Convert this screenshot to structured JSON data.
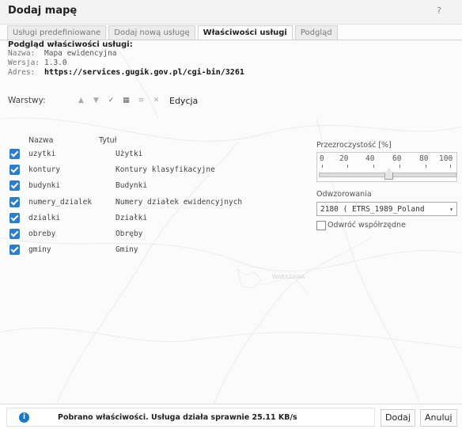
{
  "window": {
    "title": "Dodaj mapę",
    "help_icon": "question-icon"
  },
  "tabs": [
    {
      "label": "Usługi predefiniowane",
      "active": false
    },
    {
      "label": "Dodaj nową usługę",
      "active": false
    },
    {
      "label": "Właściwości usługi",
      "active": true
    },
    {
      "label": "Podgląd",
      "active": false
    }
  ],
  "info": {
    "header": "Podgląd właściwości usługi:",
    "name_label": "Nazwa:",
    "name_value": "Mapa ewidencyjna",
    "version_label": "Wersja:",
    "version_value": "1.3.0",
    "address_label": "Adres:",
    "address_value": "https://services.gugik.gov.pl/cgi-bin/3261"
  },
  "layers_toolbar": {
    "label": "Warstwy:",
    "edit_label": "Edycja",
    "icons": [
      "move-up-icon",
      "move-down-icon",
      "check-icon",
      "properties-icon",
      "list-icon",
      "remove-icon"
    ]
  },
  "layers": {
    "col_name": "Nazwa",
    "col_title": "Tytuł",
    "items": [
      {
        "name": "uzytki",
        "title": "Użytki",
        "checked": true
      },
      {
        "name": "kontury",
        "title": "Kontury klasyfikacyjne",
        "checked": true
      },
      {
        "name": "budynki",
        "title": "Budynki",
        "checked": true
      },
      {
        "name": "numery_dzialek",
        "title": "Numery działek ewidencyjnych",
        "checked": true
      },
      {
        "name": "dzialki",
        "title": "Działki",
        "checked": true
      },
      {
        "name": "obreby",
        "title": "Obręby",
        "checked": true
      },
      {
        "name": "gminy",
        "title": "Gminy",
        "checked": true
      }
    ]
  },
  "transparency": {
    "label": "Przezroczystość [%]",
    "ticks": [
      "0",
      "20",
      "40",
      "60",
      "80",
      "100"
    ],
    "value": 52
  },
  "projection": {
    "label": "Odwzorowania",
    "selected": "2180 ( ETRS_1989_Poland",
    "flip_label": "Odwróć współrzędne",
    "flip_checked": false
  },
  "map_label": "WARSZAWA",
  "status": {
    "icon": "info-icon",
    "text": "Pobrano właściwości. Usługa działa sprawnie 25.11 KB/s"
  },
  "buttons": {
    "add": "Dodaj",
    "cancel": "Anuluj"
  },
  "colors": {
    "accent": "#2f7ec4",
    "info": "#1a79c6"
  }
}
